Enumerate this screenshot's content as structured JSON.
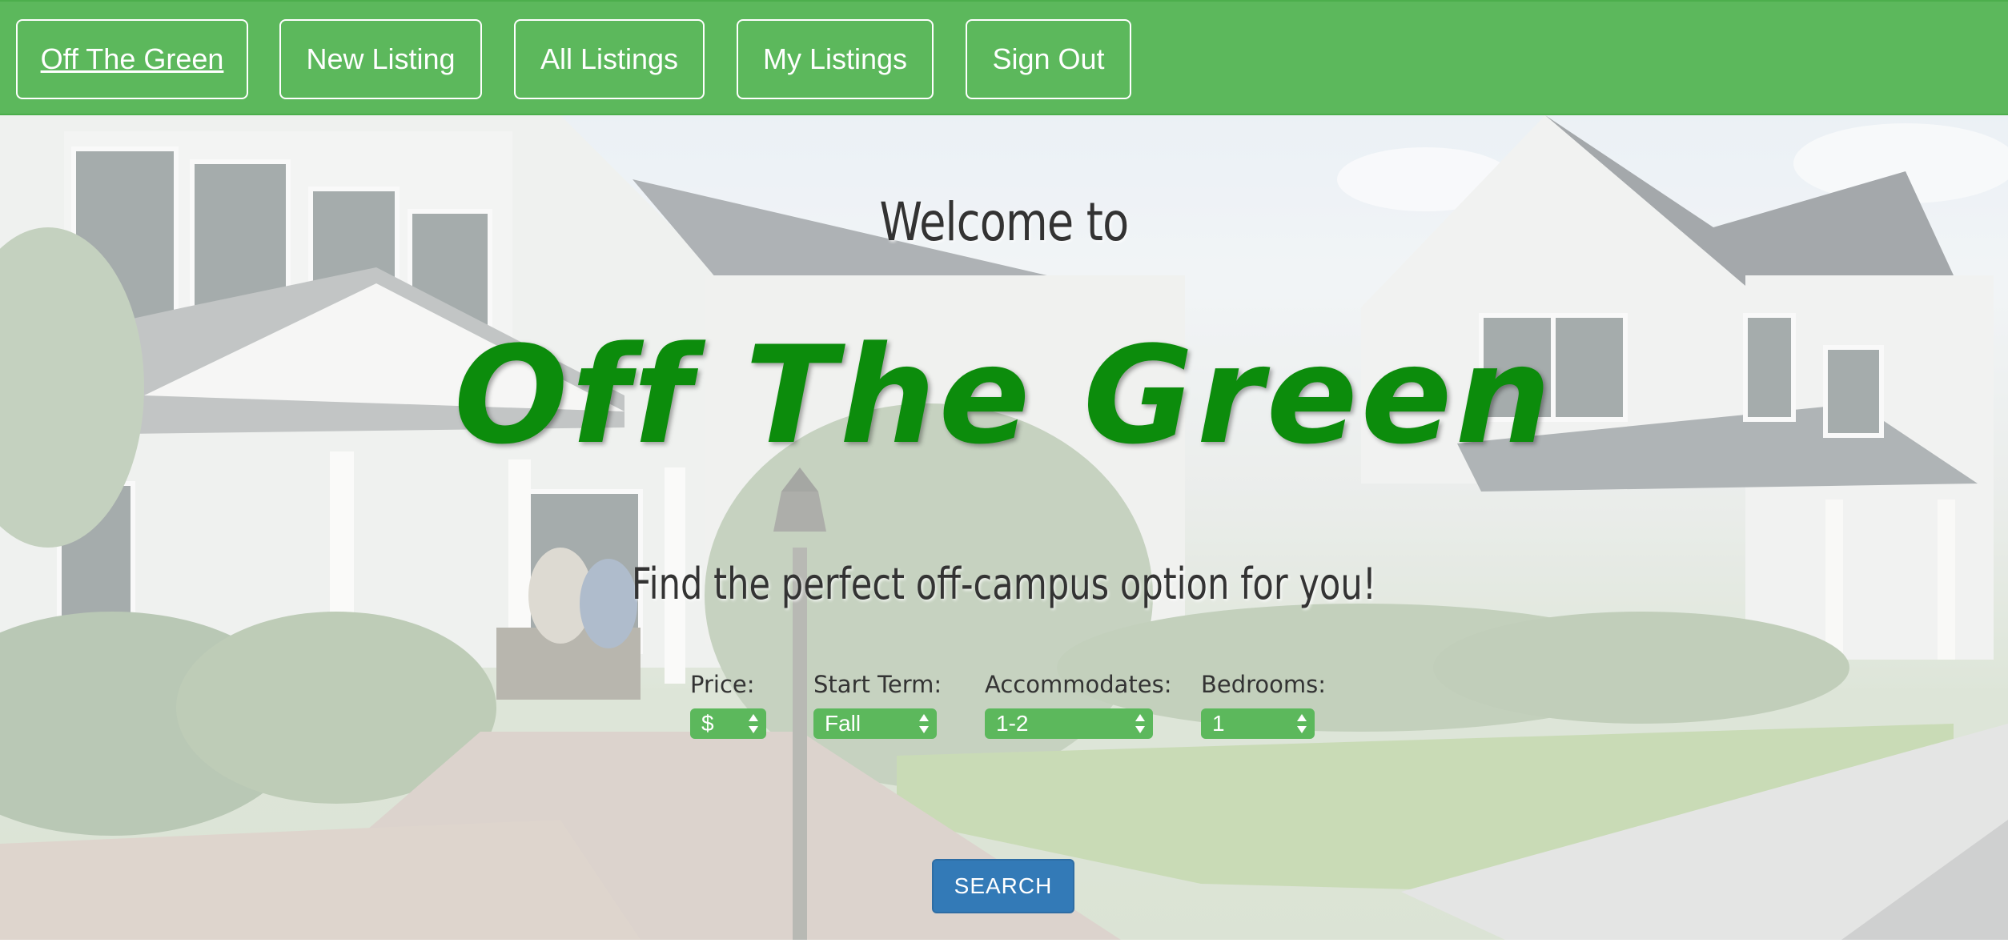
{
  "nav": {
    "items": [
      {
        "label": "Off The Green"
      },
      {
        "label": "New Listing"
      },
      {
        "label": "All Listings"
      },
      {
        "label": "My Listings"
      },
      {
        "label": "Sign Out"
      }
    ]
  },
  "hero": {
    "welcome": "Welcome to",
    "title": "Off The Green",
    "tagline": "Find the perfect off-campus option for you!"
  },
  "filters": {
    "price": {
      "label": "Price:",
      "selected": "$"
    },
    "start_term": {
      "label": "Start Term:",
      "selected": "Fall"
    },
    "accommodates": {
      "label": "Accommodates:",
      "selected": "1-2"
    },
    "bedrooms": {
      "label": "Bedrooms:",
      "selected": "1"
    }
  },
  "search": {
    "label": "SEARCH"
  },
  "colors": {
    "nav_bg": "#5cb85c",
    "brand_green": "#0c8c0c",
    "search_blue": "#337ab7"
  }
}
